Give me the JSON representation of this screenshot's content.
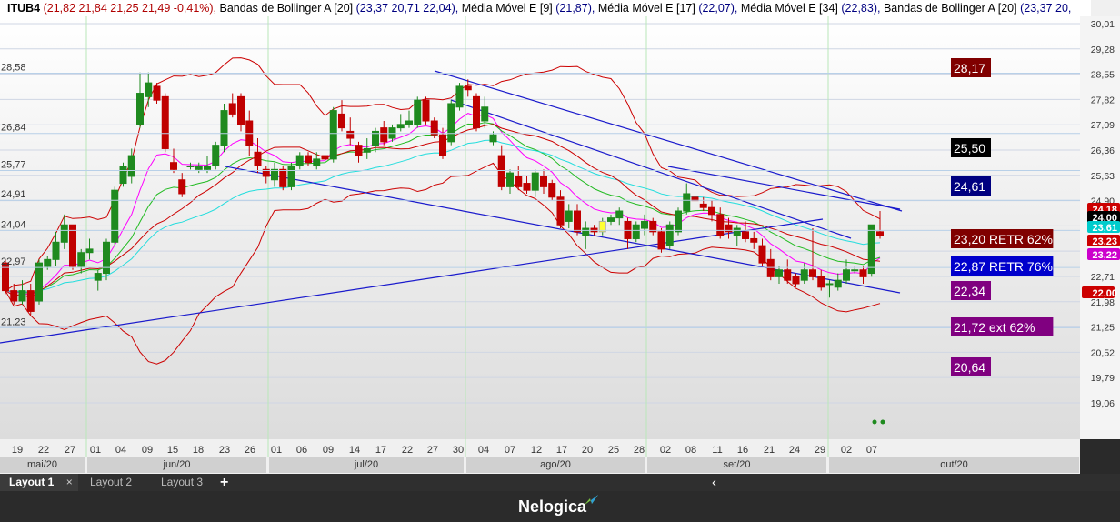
{
  "header": {
    "ticker": "ITUB4",
    "ohlc": "(21,82  21,84  21,25  21,49  -0,41%),",
    "ind1_name": "Bandas de Bollinger A [20]",
    "ind1_vals": "(23,37  20,71 22,04),",
    "ind2_name": "Média Móvel E [9]",
    "ind2_vals": "(21,87),",
    "ind3_name": "Média Móvel E [17]",
    "ind3_vals": "(22,07),",
    "ind4_name": "Média Móvel E [34]",
    "ind4_vals": "(22,83),",
    "ind5_name": "Bandas de Bollinger A [20]",
    "ind5_vals": "(23,37  20,"
  },
  "chart_data": {
    "type": "candlestick",
    "y_ticks": [
      "30,01",
      "29,28",
      "28,55",
      "27,82",
      "27,09",
      "26,36",
      "25,63",
      "24,90",
      "24,17",
      "23,44",
      "22,71",
      "21,98",
      "21,25",
      "20,52",
      "19,79",
      "19,06"
    ],
    "x_day_labels": [
      "19",
      "22",
      "27",
      "01",
      "04",
      "09",
      "15",
      "18",
      "23",
      "26",
      "01",
      "06",
      "09",
      "14",
      "17",
      "22",
      "27",
      "30",
      "04",
      "07",
      "12",
      "17",
      "20",
      "25",
      "28",
      "02",
      "08",
      "11",
      "16",
      "21",
      "24",
      "29",
      "02",
      "07"
    ],
    "months": [
      "mai/20",
      "jun/20",
      "jul/20",
      "ago/20",
      "set/20",
      "out/20"
    ],
    "left_level_labels": [
      "28,58",
      "26,84",
      "25,77",
      "24,91",
      "24,04",
      "22,97",
      "21,23"
    ],
    "level_boxes": [
      {
        "text": "28,17",
        "bg": "#800000"
      },
      {
        "text": "25,50",
        "bg": "#000000"
      },
      {
        "text": "24,61",
        "bg": "#000080"
      },
      {
        "text": "23,20 RETR 62%",
        "bg": "#800000"
      },
      {
        "text": "22,87 RETR 76%",
        "bg": "#0000cc"
      },
      {
        "text": "22,34",
        "bg": "#800080"
      },
      {
        "text": "21,72  ext 62%",
        "bg": "#800080"
      },
      {
        "text": "20,64",
        "bg": "#800080"
      }
    ],
    "price_tags": [
      {
        "text": "24,18",
        "bg": "#cc0000"
      },
      {
        "text": "24,00",
        "bg": "#000000"
      },
      {
        "text": "23,61",
        "bg": "#00cccc"
      },
      {
        "text": "23,23",
        "bg": "#cc0000"
      },
      {
        "text": "23,22",
        "bg": "#cc00cc"
      },
      {
        "text": "22,00",
        "bg": "#cc0000"
      }
    ],
    "candles": [
      [
        23.1,
        23.2,
        22.2,
        22.3
      ],
      [
        22.3,
        22.5,
        21.9,
        22.0
      ],
      [
        22.0,
        22.6,
        21.9,
        22.3
      ],
      [
        22.3,
        22.5,
        21.6,
        21.7
      ],
      [
        22.0,
        23.2,
        21.9,
        23.1
      ],
      [
        23.0,
        23.3,
        22.9,
        23.2
      ],
      [
        23.2,
        24.0,
        23.0,
        23.7
      ],
      [
        23.7,
        24.5,
        23.5,
        24.2
      ],
      [
        24.2,
        24.2,
        22.9,
        23.0
      ],
      [
        23.0,
        23.5,
        22.8,
        23.4
      ],
      [
        23.4,
        23.8,
        23.2,
        23.5
      ],
      [
        22.6,
        22.9,
        22.3,
        22.8
      ],
      [
        22.8,
        23.8,
        22.6,
        23.7
      ],
      [
        23.7,
        25.3,
        23.6,
        25.2
      ],
      [
        25.4,
        26.0,
        25.3,
        25.9
      ],
      [
        25.6,
        26.4,
        25.4,
        26.2
      ],
      [
        27.1,
        28.6,
        27.0,
        28.0
      ],
      [
        27.9,
        28.6,
        27.6,
        28.3
      ],
      [
        28.2,
        28.3,
        27.7,
        27.8
      ],
      [
        27.9,
        28.0,
        26.3,
        26.4
      ],
      [
        26.0,
        26.4,
        25.7,
        25.8
      ],
      [
        25.5,
        25.7,
        25.0,
        25.1
      ],
      [
        25.9,
        26.0,
        25.8,
        25.9
      ],
      [
        25.8,
        26.0,
        25.7,
        25.9
      ],
      [
        25.8,
        26.2,
        25.7,
        25.9
      ],
      [
        25.9,
        26.6,
        25.8,
        26.5
      ],
      [
        26.5,
        27.7,
        26.3,
        27.5
      ],
      [
        27.7,
        28.0,
        27.3,
        27.4
      ],
      [
        27.9,
        28.0,
        26.9,
        27.1
      ],
      [
        27.2,
        27.5,
        26.2,
        26.5
      ],
      [
        26.3,
        26.7,
        25.7,
        25.9
      ],
      [
        25.8,
        25.9,
        25.4,
        25.6
      ],
      [
        25.5,
        26.0,
        25.3,
        25.8
      ],
      [
        25.8,
        25.9,
        25.2,
        25.3
      ],
      [
        25.3,
        26.0,
        25.2,
        25.9
      ],
      [
        25.9,
        26.3,
        25.8,
        26.2
      ],
      [
        26.2,
        26.3,
        25.9,
        26.0
      ],
      [
        25.9,
        26.3,
        25.8,
        26.1
      ],
      [
        26.2,
        26.3,
        25.9,
        26.1
      ],
      [
        26.1,
        27.6,
        26.0,
        27.5
      ],
      [
        27.4,
        27.8,
        26.9,
        27.0
      ],
      [
        26.9,
        27.3,
        26.5,
        26.7
      ],
      [
        26.5,
        26.6,
        26.0,
        26.2
      ],
      [
        26.3,
        26.7,
        26.1,
        26.4
      ],
      [
        26.5,
        27.0,
        26.3,
        26.9
      ],
      [
        27.0,
        27.2,
        26.5,
        26.6
      ],
      [
        26.7,
        27.1,
        26.6,
        27.0
      ],
      [
        27.0,
        27.4,
        26.9,
        27.1
      ],
      [
        27.1,
        27.5,
        27.0,
        27.2
      ],
      [
        27.1,
        27.9,
        27.0,
        27.8
      ],
      [
        27.8,
        27.9,
        27.1,
        27.2
      ],
      [
        27.2,
        27.3,
        26.7,
        26.8
      ],
      [
        26.8,
        27.0,
        26.1,
        26.2
      ],
      [
        26.6,
        27.8,
        26.5,
        27.7
      ],
      [
        27.6,
        28.3,
        27.5,
        28.2
      ],
      [
        28.2,
        28.4,
        27.9,
        28.1
      ],
      [
        27.9,
        28.0,
        26.9,
        27.0
      ],
      [
        27.2,
        27.9,
        27.0,
        27.6
      ],
      [
        26.6,
        26.9,
        26.5,
        26.8
      ],
      [
        26.2,
        26.5,
        25.2,
        25.3
      ],
      [
        25.3,
        25.8,
        25.1,
        25.7
      ],
      [
        25.6,
        25.9,
        25.2,
        25.3
      ],
      [
        25.4,
        25.6,
        25.1,
        25.2
      ],
      [
        25.2,
        25.8,
        25.0,
        25.7
      ],
      [
        25.6,
        25.8,
        25.1,
        25.3
      ],
      [
        25.4,
        25.5,
        24.9,
        25.0
      ],
      [
        25.0,
        25.2,
        24.1,
        24.2
      ],
      [
        24.3,
        24.8,
        24.1,
        24.6
      ],
      [
        24.6,
        24.8,
        23.9,
        24.0
      ],
      [
        23.9,
        24.3,
        23.5,
        24.1
      ],
      [
        24.1,
        24.2,
        23.9,
        24.0
      ],
      [
        24.0,
        24.4,
        23.9,
        24.3
      ],
      [
        24.3,
        24.5,
        24.2,
        24.4
      ],
      [
        24.4,
        24.7,
        24.2,
        24.6
      ],
      [
        24.3,
        24.4,
        23.5,
        23.8
      ],
      [
        23.8,
        24.3,
        23.7,
        24.2
      ],
      [
        24.1,
        24.5,
        23.9,
        24.3
      ],
      [
        24.3,
        24.4,
        23.9,
        24.0
      ],
      [
        24.0,
        24.1,
        23.4,
        23.5
      ],
      [
        23.6,
        24.3,
        23.5,
        24.2
      ],
      [
        24.0,
        24.7,
        23.9,
        24.6
      ],
      [
        24.6,
        25.4,
        24.5,
        25.1
      ],
      [
        25.0,
        25.1,
        24.7,
        24.9
      ],
      [
        24.8,
        25.0,
        24.6,
        24.7
      ],
      [
        24.7,
        24.9,
        24.3,
        24.5
      ],
      [
        24.5,
        24.7,
        23.8,
        23.9
      ],
      [
        24.2,
        24.4,
        23.8,
        24.0
      ],
      [
        23.9,
        24.2,
        23.6,
        24.1
      ],
      [
        24.0,
        24.3,
        23.7,
        23.8
      ],
      [
        23.8,
        24.0,
        23.5,
        23.7
      ],
      [
        23.6,
        23.8,
        23.0,
        23.1
      ],
      [
        23.2,
        23.5,
        22.6,
        22.7
      ],
      [
        22.7,
        23.0,
        22.5,
        22.9
      ],
      [
        22.9,
        23.2,
        22.5,
        22.6
      ],
      [
        22.7,
        22.8,
        22.4,
        22.5
      ],
      [
        22.6,
        23.1,
        22.5,
        22.9
      ],
      [
        22.9,
        24.1,
        22.6,
        22.7
      ],
      [
        22.7,
        22.9,
        22.3,
        22.4
      ],
      [
        22.5,
        22.6,
        22.1,
        22.5
      ],
      [
        22.4,
        22.8,
        22.3,
        22.6
      ],
      [
        22.6,
        23.2,
        22.5,
        22.9
      ],
      [
        22.9,
        23.0,
        22.8,
        22.9
      ],
      [
        22.9,
        23.0,
        22.5,
        22.7
      ],
      [
        22.8,
        24.2,
        22.7,
        24.2
      ],
      [
        24.0,
        24.6,
        23.8,
        23.9
      ]
    ]
  },
  "months_bar": [
    "mai/20",
    "jun/20",
    "jul/20",
    "ago/20",
    "set/20",
    "out/20"
  ],
  "tabs": {
    "tab1": "Layout 1",
    "tab2": "Layout 2",
    "tab3": "Layout 3",
    "add": "+",
    "close": "×",
    "prev": "‹"
  },
  "footer": {
    "logo": "Nelogica"
  }
}
